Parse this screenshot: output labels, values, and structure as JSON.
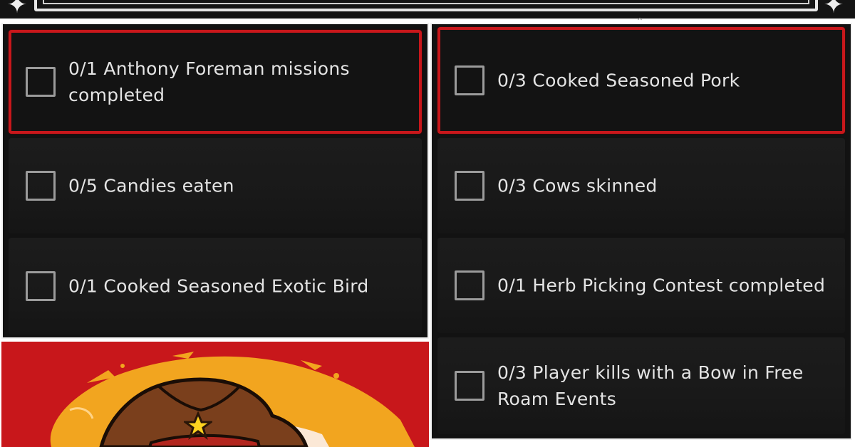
{
  "challenges": {
    "left": [
      {
        "label": "0/1 Anthony Foreman missions completed",
        "line1": "0/1 Anthony Foreman missions",
        "line2": "completed",
        "highlighted": true
      },
      {
        "label": "0/5 Candies eaten",
        "highlighted": false
      },
      {
        "label": "0/1 Cooked Seasoned Exotic Bird",
        "highlighted": false
      }
    ],
    "right": [
      {
        "label": "0/3 Cooked Seasoned Pork",
        "highlighted": true
      },
      {
        "label": "0/3 Cows skinned",
        "highlighted": false
      },
      {
        "label": "0/1 Herb Picking Contest completed",
        "highlighted": false
      },
      {
        "label": "0/3 Player kills with a Bow in Free Roam Events",
        "line1": "0/3 Player kills with a Bow in Free",
        "line2": "Roam Events",
        "highlighted": false
      }
    ]
  },
  "colors": {
    "highlight": "#c8171b",
    "panel": "#121212",
    "text": "#e4e4e4",
    "art_background": "#c8171b",
    "art_splash": "#f2a51f",
    "hat": "#7a3f1c"
  },
  "icons": [
    "star-icon",
    "caret-icon",
    "checkbox-icon",
    "hat-illustration",
    "sheriff-star-icon"
  ]
}
